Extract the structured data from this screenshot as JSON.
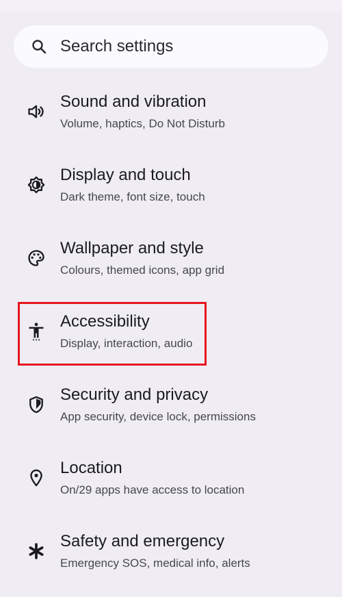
{
  "search": {
    "placeholder": "Search settings",
    "icon": "search-icon"
  },
  "items": [
    {
      "title": "Sound and vibration",
      "subtitle": "Volume, haptics, Do Not Disturb",
      "icon": "speaker-icon"
    },
    {
      "title": "Display and touch",
      "subtitle": "Dark theme, font size, touch",
      "icon": "brightness-icon"
    },
    {
      "title": "Wallpaper and style",
      "subtitle": "Colours, themed icons, app grid",
      "icon": "palette-icon"
    },
    {
      "title": "Accessibility",
      "subtitle": "Display, interaction, audio",
      "icon": "accessibility-icon",
      "highlighted": true
    },
    {
      "title": "Security and privacy",
      "subtitle": "App security, device lock, permissions",
      "icon": "shield-icon"
    },
    {
      "title": "Location",
      "subtitle": "On/29 apps have access to location",
      "icon": "location-pin-icon"
    },
    {
      "title": "Safety and emergency",
      "subtitle": "Emergency SOS, medical info, alerts",
      "icon": "asterisk-icon"
    }
  ],
  "colors": {
    "background": "#efedf3",
    "search_background": "#fbfaff",
    "highlight_border": "#e8141e"
  }
}
